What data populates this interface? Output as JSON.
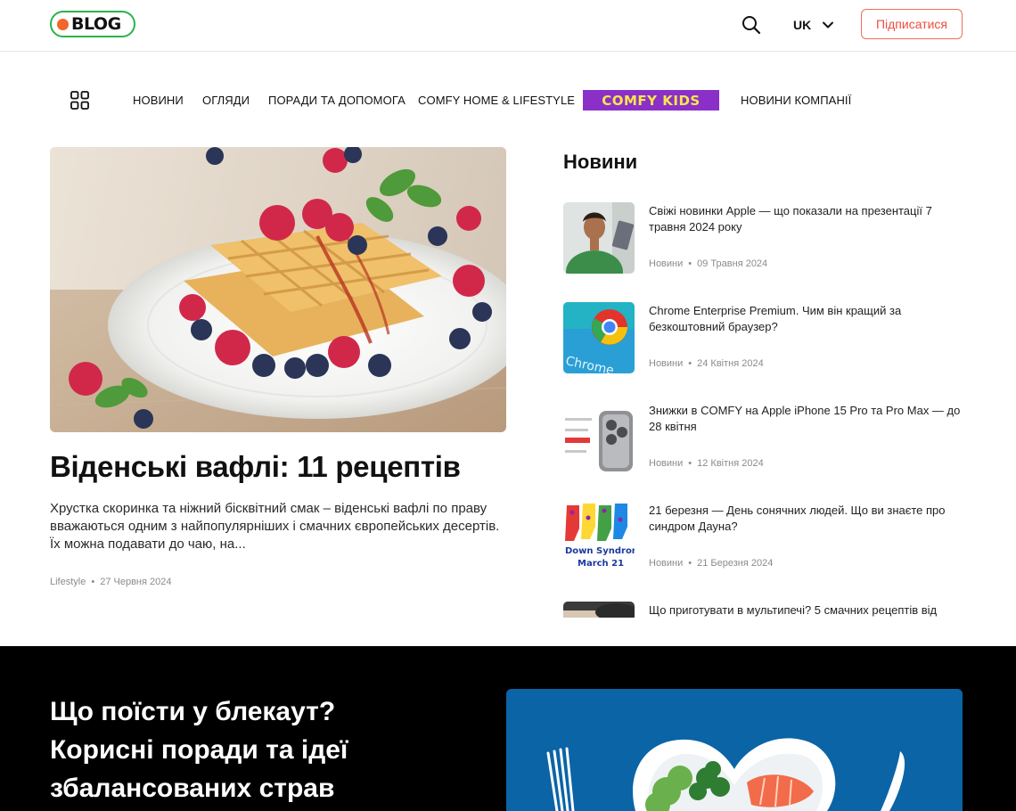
{
  "header": {
    "logo_text": "BLOG",
    "search_icon": "search-icon",
    "language": "UK",
    "subscribe_label": "Підписатися"
  },
  "nav": {
    "menu_icon": "grid-icon",
    "items": [
      {
        "label": "НОВИНИ"
      },
      {
        "label": "ОГЛЯДИ"
      },
      {
        "label": "ПОРАДИ ТА ДОПОМОГА"
      },
      {
        "label": "COMFY HOME & LIFESTYLE"
      },
      {
        "label": "COMFY KIDS"
      },
      {
        "label": "НОВИНИ КОМПАНІЇ"
      }
    ]
  },
  "featured": {
    "title": "Віденські вафлі: 11 рецептів",
    "excerpt": "Хрустка скоринка та ніжний бісквітний смак – віденські вафлі по праву вважаються одним з найпопулярніших і смачних європейських десертів. Їх можна подавати до чаю, на...",
    "category": "Lifestyle",
    "date": "27 Червня 2024"
  },
  "news": {
    "heading": "Новини",
    "items": [
      {
        "title": "Свіжі новинки Apple — що показали на презентації 7 травня 2024 року",
        "category": "Новини",
        "date": "09 Травня 2024"
      },
      {
        "title": "Chrome Enterprise Premium. Чим він кращий за безкоштовний браузер?",
        "category": "Новини",
        "date": "24 Квітня 2024"
      },
      {
        "title": "Знижки в COMFY на Apple iPhone 15 Pro та Pro Max — до 28 квітня",
        "category": "Новини",
        "date": "12 Квітня 2024"
      },
      {
        "title": "21 березня — День сонячних людей. Що ви знаєте про синдром Дауна?",
        "category": "Новини",
        "date": "21 Березня 2024"
      },
      {
        "title": "Що приготувати в мультипечі? 5 смачних рецептів від",
        "category": "",
        "date": ""
      }
    ],
    "thumb_texts": {
      "chrome": "Chrome",
      "down1": "Down Syndrome",
      "down2": "March 21"
    }
  },
  "promo": {
    "title": "Що поїсти у блекаут? Корисні поради та ідеї збалансованих страв"
  },
  "colors": {
    "accent": "#ef4b3f",
    "logo_green": "#2bb24c",
    "logo_orange": "#f2662b",
    "kids_purple": "#8b2fc9",
    "kids_yellow": "#f6e84a",
    "dark_bg": "#000000",
    "promo_blue": "#0a64a6"
  }
}
